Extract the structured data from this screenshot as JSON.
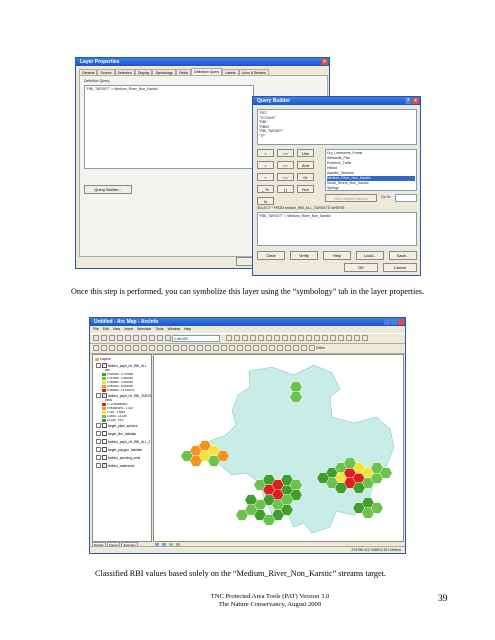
{
  "screenshot1": {
    "layer_props": {
      "title": "Layer Properties",
      "tabs": [
        "General",
        "Source",
        "Selection",
        "Display",
        "Symbology",
        "Fields",
        "Definition Query",
        "Labels",
        "Joins & Relates"
      ],
      "definition_query_label": "Definition Query:",
      "query_text": "\"RBI_TARGET\" = Medium_River_Non_Karstic'",
      "query_builder_button": "Query Builder...",
      "ok_button": "OK"
    },
    "query_builder": {
      "title": "Query Builder",
      "fields": [
        "\"FID\"",
        "\"TCOUNT\"",
        "\"RBI\"",
        "\"RBIN\"",
        "\"RBI_TARGET\"",
        "\"TF\""
      ],
      "operators": [
        "=",
        "<>",
        "Like",
        ">",
        ">=",
        "And",
        "<",
        "<=",
        "Or",
        "_ %",
        "()",
        "Not",
        "Is"
      ],
      "values": [
        "Dry_Limestone_Forest",
        "Wetlands_Fish",
        "Endemic_Turtle",
        "Hellad",
        "Aquatic_Streams",
        "Medium_River_Non_Karstic",
        "Small_Rivers_Non_Karstic",
        "Springs"
      ],
      "selected_value": "Medium_River_Non_Karstic",
      "get_unique_values": "Get Unique Values",
      "go_to": "Go To:",
      "select_statement": "SELECT * FROM tedtdor_RBI_ALL_TARGETS WHERE:",
      "where_clause": "\"RBI_TARGET\" = Medium_River_Non_Karstic'",
      "buttons": [
        "Clear",
        "Verify",
        "Help",
        "Load...",
        "Save..."
      ],
      "ok": "OK",
      "cancel": "Cancel"
    }
  },
  "caption1": "Once this step is performed, you can symbolize this layer using the “symbology” tab in the layer properties.",
  "screenshot2": {
    "title": "Untitled - Arc Map - ArcInfo",
    "menu": [
      "File",
      "Edit",
      "View",
      "Insert",
      "Selection",
      "Tools",
      "Window",
      "Help"
    ],
    "scale": "1:48,000",
    "editor_label": "Editor",
    "toc_title": "Layers",
    "layers": [
      {
        "name": "tedtdor_paph_rbi_RBI_ALL",
        "sub": "RBI"
      },
      {
        "name": "tedtdor_paph_rbi_RBI_TARGET",
        "sub": "RBIN"
      },
      {
        "name": "target_plant_species"
      },
      {
        "name": "target_fine_habitats"
      },
      {
        "name": "tedtdor_paph_rbi_RBI_ALL_2"
      },
      {
        "name": "target_polygon_habitats"
      },
      {
        "name": "tedtdor_planning_units"
      },
      {
        "name": "tedtdor_watershed"
      }
    ],
    "legend_a": [
      "0.526329 - 0.747595",
      "0.747595 - 1.060066",
      "1.060066 - 4.281919",
      "4.281919 - 8.293606",
      "8.293606 - 13.216174"
    ],
    "legend_b": [
      "0 - 0.564966352",
      "0.564966352 - 1.132",
      "1.132 - 1.6949",
      "1.6949 - 12.165",
      "12.165 - 15.0"
    ],
    "toc_tabs": [
      "Display",
      "Source",
      "Selection"
    ],
    "status": "204786.412  406802.301 Meters",
    "colors": {
      "dark_green": "#3f9f2a",
      "green": "#6cc24a",
      "yellow": "#f3e33a",
      "orange": "#f49322",
      "red": "#e01e1e",
      "watershed": "#c8ece6"
    }
  },
  "caption2": "Classified RBI values based solely on the “Medium_River_Non_Karstic” streams target.",
  "footer": {
    "line1": "TNC Protected Area Tools (PAT) Version 3.0",
    "line2": "The Nature Conservancy, August 2009",
    "page_number": "39"
  }
}
